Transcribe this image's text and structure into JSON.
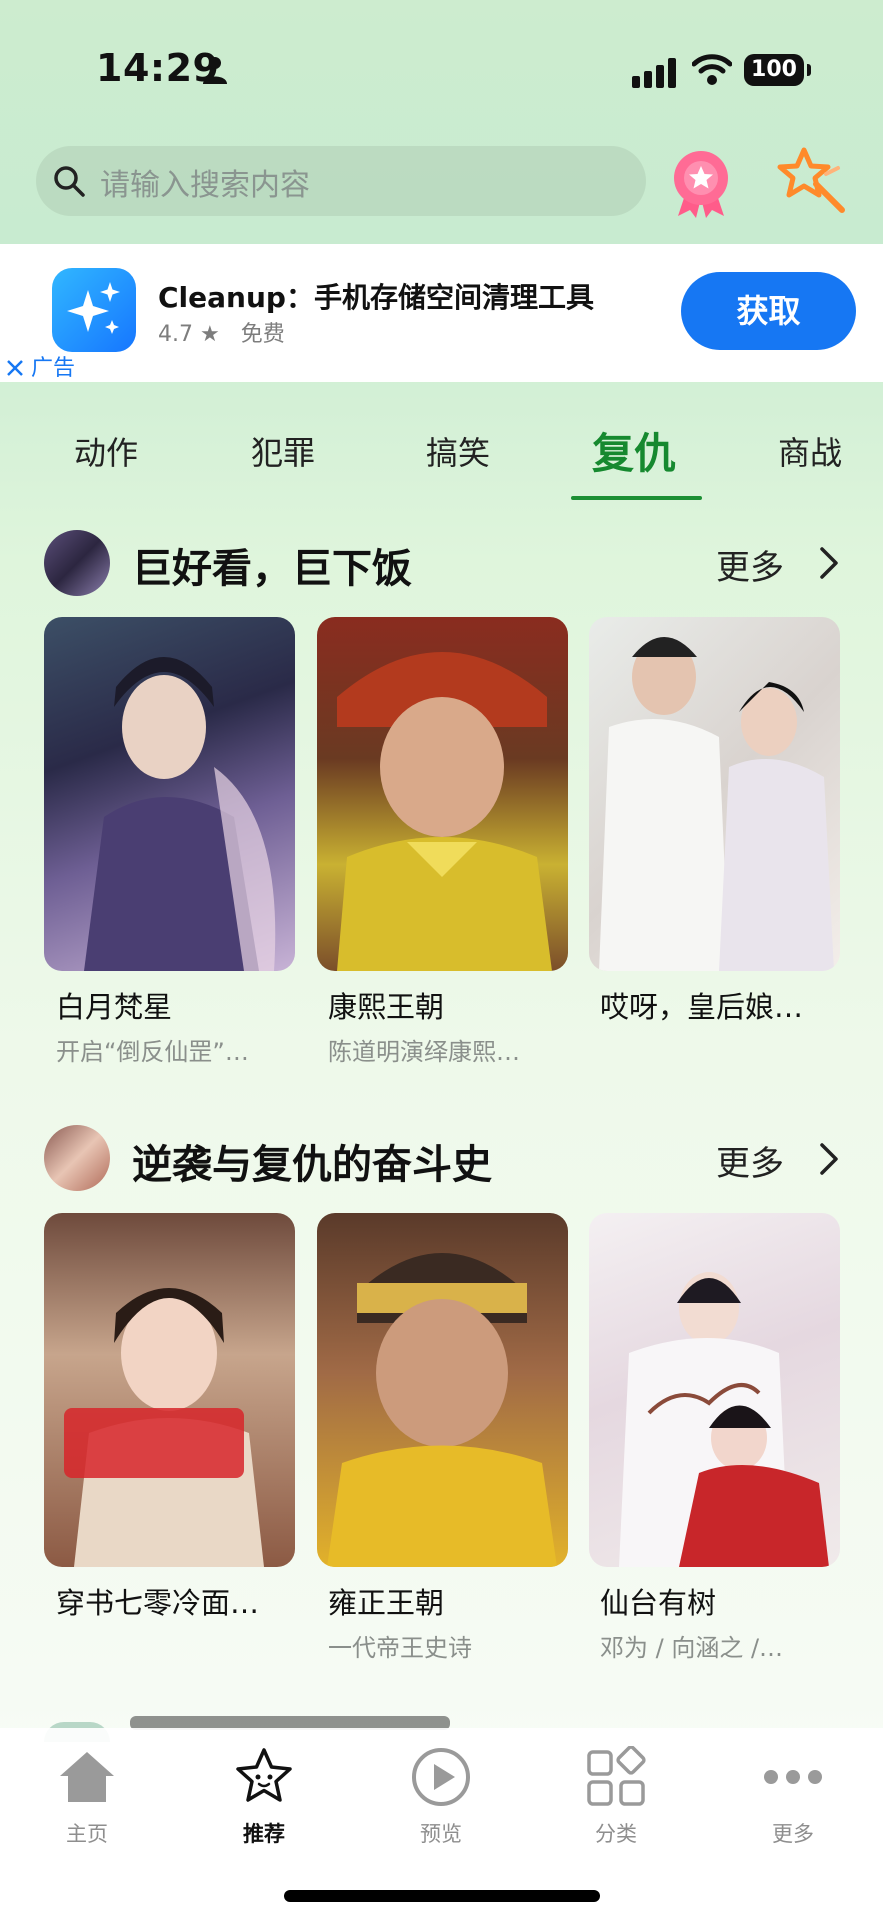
{
  "status_bar": {
    "time": "14:29",
    "battery": "100"
  },
  "search": {
    "placeholder": "请输入搜索内容"
  },
  "ad": {
    "app_name": "Cleanup：手机存储空间清理工具",
    "rating": "4.7 ★",
    "price": "免费",
    "get_label": "获取",
    "ad_label": "广告"
  },
  "tabs": [
    {
      "label": "动作"
    },
    {
      "label": "犯罪"
    },
    {
      "label": "搞笑"
    },
    {
      "label": "复仇",
      "active": true
    },
    {
      "label": "商战"
    }
  ],
  "sections": [
    {
      "title": "巨好看，巨下饭",
      "more": "更多",
      "items": [
        {
          "title": "白月梵星",
          "subtitle": "开启“倒反仙罡”…"
        },
        {
          "title": "康熙王朝",
          "subtitle": "陈道明演绎康熙…"
        },
        {
          "title": "哎呀，皇后娘…",
          "subtitle": ""
        }
      ]
    },
    {
      "title": "逆袭与复仇的奋斗史",
      "more": "更多",
      "items": [
        {
          "title": "穿书七零冷面…",
          "subtitle": ""
        },
        {
          "title": "雍正王朝",
          "subtitle": "一代帝王史诗"
        },
        {
          "title": "仙台有树",
          "subtitle": "邓为 / 向涵之 /…"
        }
      ]
    }
  ],
  "tabbar": [
    {
      "label": "主页",
      "icon": "home-icon"
    },
    {
      "label": "推荐",
      "icon": "star-face-icon",
      "active": true
    },
    {
      "label": "预览",
      "icon": "play-icon"
    },
    {
      "label": "分类",
      "icon": "category-icon"
    },
    {
      "label": "更多",
      "icon": "more-icon"
    }
  ],
  "colors": {
    "accent_green": "#16892f",
    "ad_blue": "#1677f3"
  }
}
